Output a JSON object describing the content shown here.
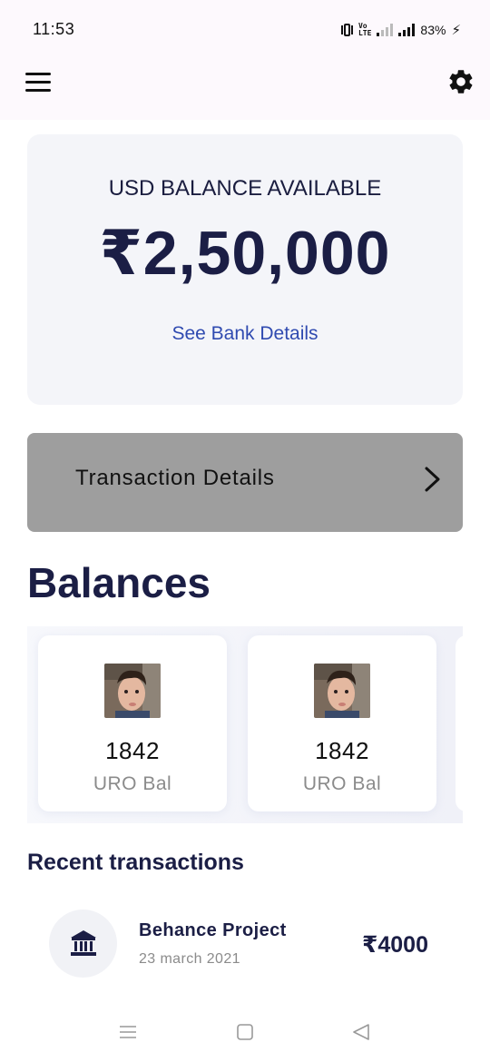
{
  "status_bar": {
    "time": "11:53",
    "battery": "83%",
    "icons": [
      "vibrate-icon",
      "volte-icon",
      "signal-weak-icon",
      "signal-icon",
      "charging-bolt-icon"
    ]
  },
  "app_bar": {
    "icons": [
      "hamburger-menu-icon",
      "gear-icon"
    ]
  },
  "balance_card": {
    "label": "USD BALANCE AVAILABLE",
    "amount": "₹2,50,000",
    "link": "See Bank Details",
    "link_color": "#2f4ab0"
  },
  "transaction_details": {
    "label": "Transaction Details",
    "background": "#9e9e9e"
  },
  "balances": {
    "title": "Balances",
    "cards": [
      {
        "value": "1842",
        "label": "URO Bal"
      },
      {
        "value": "1842",
        "label": "URO Bal"
      }
    ]
  },
  "recent_transactions": {
    "title": "Recent transactions",
    "items": [
      {
        "name": "Behance Project",
        "date": "23 march 2021",
        "amount": "₹4000",
        "icon": "bank-icon"
      }
    ]
  },
  "nav_bar": {
    "icons": [
      "recents-icon",
      "home-icon",
      "back-icon"
    ]
  },
  "colors": {
    "primary_text": "#1b1e45",
    "card_bg": "#f4f5f9",
    "muted_text": "#8b8b8b"
  }
}
